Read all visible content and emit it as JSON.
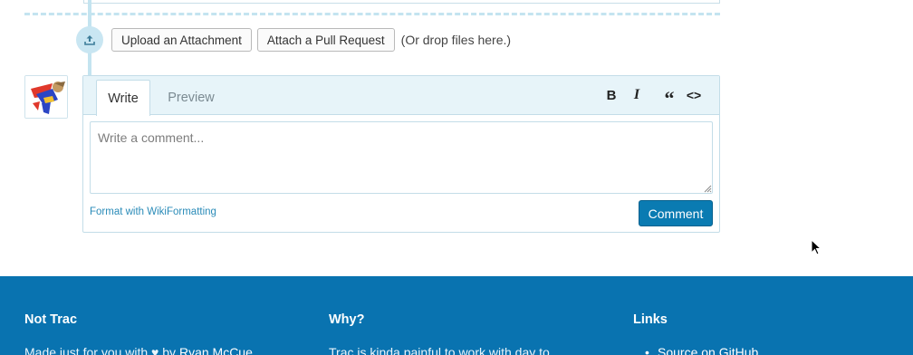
{
  "attachments": {
    "upload_label": "Upload an Attachment",
    "pull_request_label": "Attach a Pull Request",
    "drop_hint": "(Or drop files here.)"
  },
  "editor": {
    "tabs": [
      {
        "label": "Write",
        "active": true
      },
      {
        "label": "Preview",
        "active": false
      }
    ],
    "toolbar": {
      "bold": "B",
      "italic": "I",
      "quote": "“",
      "code": "<>"
    },
    "placeholder": "Write a comment...",
    "format_link": "Format with WikiFormatting",
    "submit_label": "Comment"
  },
  "footer": {
    "col1": {
      "title": "Not Trac",
      "text_prefix": "Made just for you with ♥ by ",
      "author": "Ryan McCue"
    },
    "col2": {
      "title": "Why?",
      "text": "Trac is kinda painful to work with day to"
    },
    "col3": {
      "title": "Links",
      "item": "Source on GitHub"
    }
  },
  "colors": {
    "accent": "#0a7bb2",
    "footer_bg": "#0973b0",
    "timeline": "#c4e4f0"
  }
}
